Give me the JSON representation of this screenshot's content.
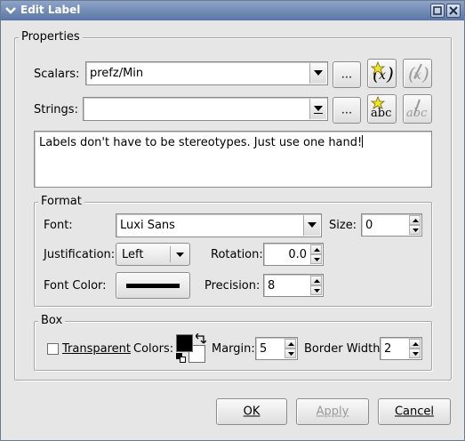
{
  "window": {
    "title": "Edit Label"
  },
  "properties": {
    "legend": "Properties",
    "scalars_label": "Scalars:",
    "scalars_value": "prefz/Min",
    "strings_label": "Strings:",
    "strings_value": "",
    "browse_label": "...",
    "text": "Labels don't have to be stereotypes.  Just use one hand!"
  },
  "format": {
    "legend": "Format",
    "font_label": "Font:",
    "font_value": "Luxi Sans",
    "size_label": "Size:",
    "size_value": "0",
    "justification_label": "Justification:",
    "justification_value": "Left",
    "rotation_label": "Rotation:",
    "rotation_value": "0.0",
    "font_color_label": "Font Color:",
    "precision_label": "Precision:",
    "precision_value": "8"
  },
  "box": {
    "legend": "Box",
    "transparent_label": "Transparent",
    "colors_label": "Colors:",
    "margin_label": "Margin:",
    "margin_value": "5",
    "border_width_label": "Border Width:",
    "border_width_value": "2"
  },
  "buttons": {
    "ok": "OK",
    "apply": "Apply",
    "cancel": "Cancel"
  },
  "icons": {
    "window_menu": "chevron-down-icon",
    "minimize": "minimize-icon",
    "close": "close-icon",
    "scalar_new": "scalar-star-icon",
    "scalar_edit": "scalar-edit-icon",
    "string_new": "abc-star-icon",
    "string_edit": "abc-edit-icon",
    "swap_colors": "swap-arrows-icon"
  },
  "colors": {
    "titlebar": "#5b76a6",
    "font_color_swatch": "#000000",
    "fg_color": "#000000",
    "bg_color": "#ffffff"
  }
}
